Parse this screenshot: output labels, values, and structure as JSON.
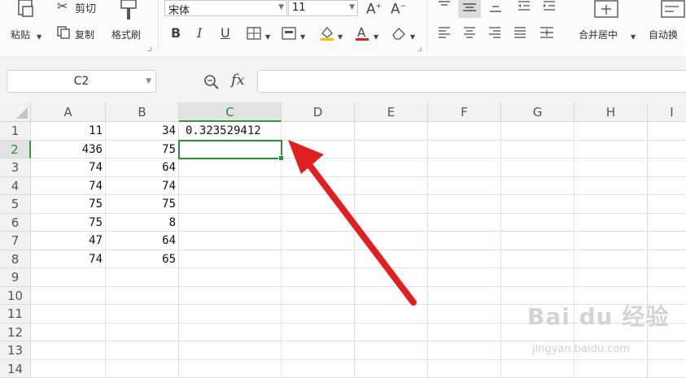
{
  "ribbon": {
    "cut": "剪切",
    "paste": "粘贴",
    "copy": "复制",
    "format_painter": "格式刷",
    "font_name": "宋体",
    "font_size": "11",
    "merge_center": "合并居中",
    "wrap_text": "自动换"
  },
  "formula_bar": {
    "name_box": "C2",
    "fx": "fx",
    "content": ""
  },
  "sheet": {
    "columns": [
      "A",
      "B",
      "C",
      "D",
      "E",
      "F",
      "G",
      "H",
      "I"
    ],
    "rows": [
      "1",
      "2",
      "3",
      "4",
      "5",
      "6",
      "7",
      "8",
      "9",
      "10",
      "11",
      "12",
      "13",
      "14"
    ],
    "A": [
      "11",
      "436",
      "74",
      "74",
      "75",
      "75",
      "47",
      "74"
    ],
    "B": [
      "34",
      "75",
      "64",
      "74",
      "75",
      "8",
      "64",
      "65"
    ],
    "C1": "0.323529412",
    "selected_cell": "C2"
  },
  "watermark": {
    "brand": "Bai du 经验",
    "url": "jingyan.baidu.com"
  },
  "colors": {
    "selection": "#2e8f38",
    "arrow": "#e0201e"
  }
}
